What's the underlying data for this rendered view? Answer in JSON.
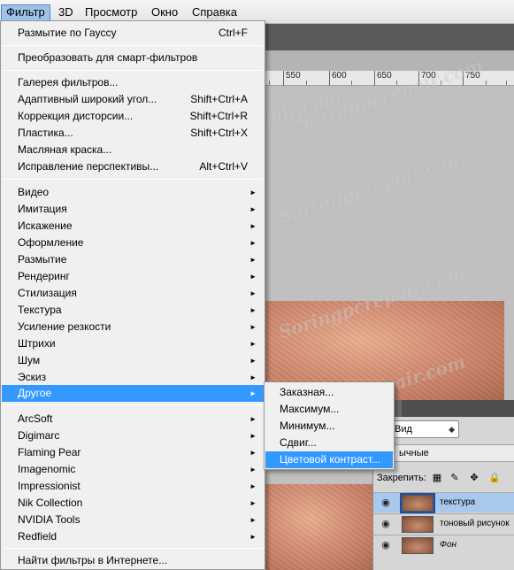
{
  "menubar": {
    "items": [
      "Фильтр",
      "3D",
      "Просмотр",
      "Окно",
      "Справка"
    ]
  },
  "ruler": {
    "ticks": [
      "550",
      "600",
      "650",
      "700",
      "750"
    ]
  },
  "watermark": "Soringpcrepair.com",
  "filter_menu": {
    "items": [
      {
        "label": "Размытие по Гауссу",
        "shortcut": "Ctrl+F"
      },
      {
        "label": "Преобразовать для смарт-фильтров"
      },
      {
        "label": "Галерея фильтров..."
      },
      {
        "label": "Адаптивный широкий угол...",
        "shortcut": "Shift+Ctrl+A"
      },
      {
        "label": "Коррекция дисторсии...",
        "shortcut": "Shift+Ctrl+R"
      },
      {
        "label": "Пластика...",
        "shortcut": "Shift+Ctrl+X"
      },
      {
        "label": "Масляная краска..."
      },
      {
        "label": "Исправление перспективы...",
        "shortcut": "Alt+Ctrl+V"
      },
      {
        "label": "Видео"
      },
      {
        "label": "Имитация"
      },
      {
        "label": "Искажение"
      },
      {
        "label": "Оформление"
      },
      {
        "label": "Размытие"
      },
      {
        "label": "Рендеринг"
      },
      {
        "label": "Стилизация"
      },
      {
        "label": "Текстура"
      },
      {
        "label": "Усиление резкости"
      },
      {
        "label": "Штрихи"
      },
      {
        "label": "Шум"
      },
      {
        "label": "Эскиз"
      },
      {
        "label": "Другое"
      },
      {
        "label": "ArcSoft"
      },
      {
        "label": "Digimarc"
      },
      {
        "label": "Flaming Pear"
      },
      {
        "label": "Imagenomic"
      },
      {
        "label": "Impressionist"
      },
      {
        "label": "Nik Collection"
      },
      {
        "label": "NVIDIA Tools"
      },
      {
        "label": "Redfield"
      },
      {
        "label": "Найти фильтры в Интернете..."
      }
    ],
    "arrow": "►"
  },
  "other_submenu": {
    "items": [
      "Заказная...",
      "Максимум...",
      "Минимум...",
      "Сдвиг...",
      "Цветовой контраст..."
    ]
  },
  "layers_panel": {
    "tab_label": "и",
    "view_select": "Вид",
    "blend_mode_partial": "ычные",
    "lock_label": "Закрепить:",
    "layers": [
      {
        "name": "текстура",
        "selected": true
      },
      {
        "name": "тоновый рисунок",
        "selected": false
      },
      {
        "name": "Фон",
        "selected": false
      }
    ]
  },
  "colors": {
    "highlight": "#3399ff",
    "menu_bg": "#f0f0f0",
    "selected_layer": "#a9c8ee"
  }
}
